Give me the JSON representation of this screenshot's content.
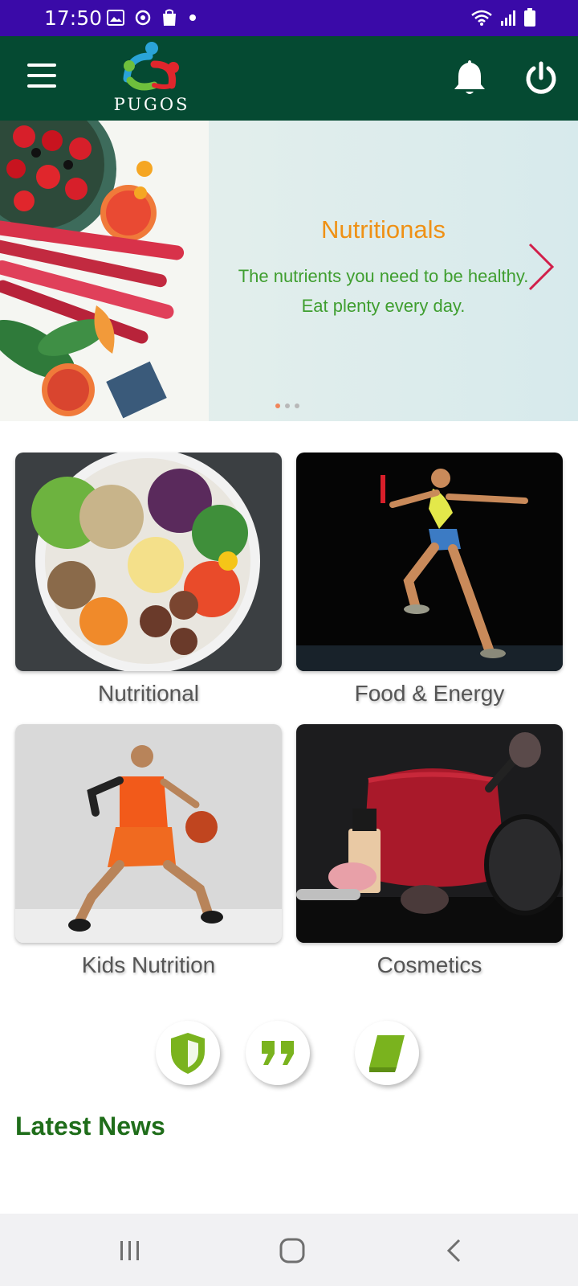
{
  "status_bar": {
    "time": "17:50",
    "icons": [
      "gallery-icon",
      "sync-icon",
      "bag-icon",
      "dot-icon",
      "wifi-icon",
      "signal-icon",
      "battery-icon"
    ]
  },
  "app_bar": {
    "logo_text": "PUGOS",
    "icons": [
      "menu-icon",
      "bell-icon",
      "power-icon"
    ],
    "background": "#054a32"
  },
  "banner": {
    "title": "Nutritionals",
    "line1": "The nutrients you need to be healthy.",
    "line2": "Eat plenty every day.",
    "slide_count": 3,
    "active_slide": 1
  },
  "categories": [
    {
      "label": "Nutritional"
    },
    {
      "label": "Food & Energy"
    },
    {
      "label": "Kids Nutrition"
    },
    {
      "label": "Cosmetics"
    }
  ],
  "actions": [
    {
      "icon": "shield-icon"
    },
    {
      "icon": "quote-icon"
    },
    {
      "icon": "book-icon"
    }
  ],
  "news": {
    "title": "Latest News"
  },
  "colors": {
    "status_bar": "#3a0aa8",
    "accent_orange": "#ef9115",
    "accent_green": "#3f9e2f",
    "icon_green": "#7ab31e"
  },
  "nav": {
    "icons": [
      "recents-icon",
      "home-icon",
      "back-icon"
    ]
  }
}
